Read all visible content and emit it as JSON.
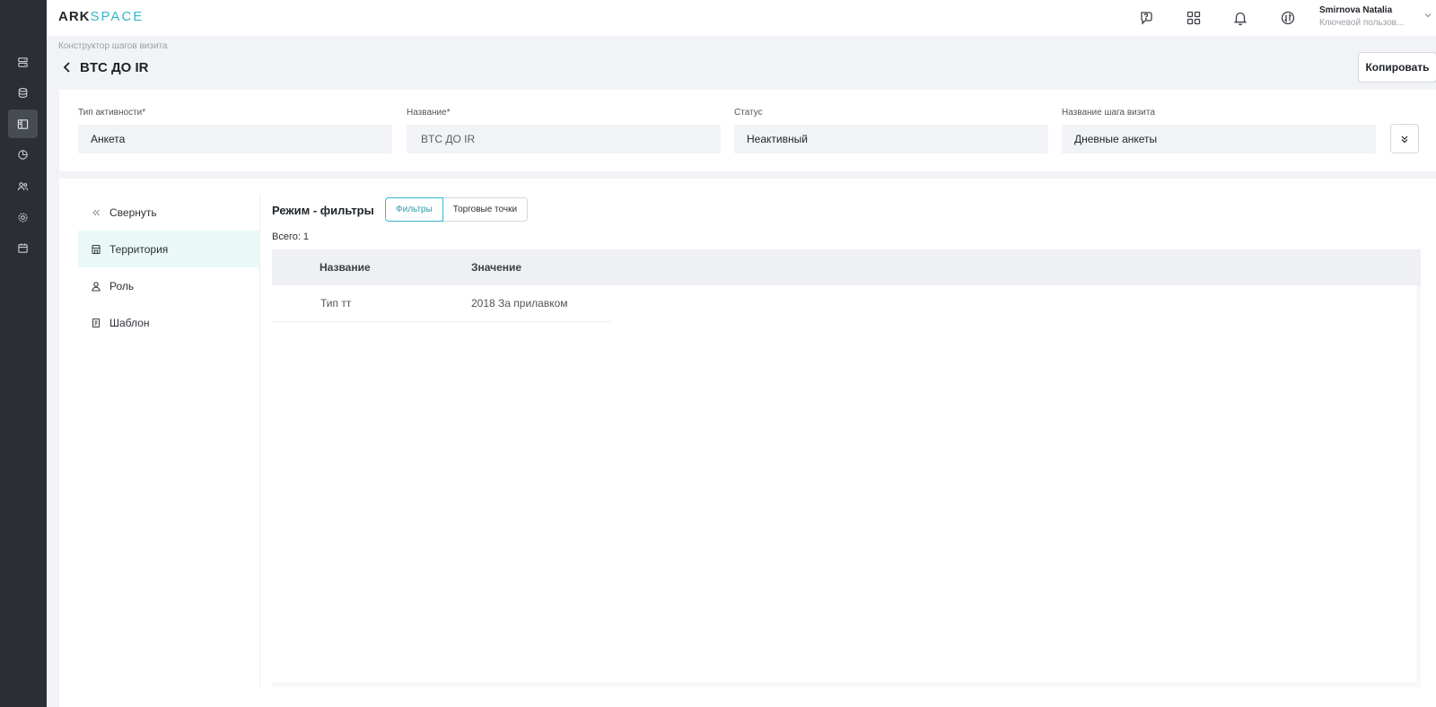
{
  "app": {
    "logo_primary": "ARK",
    "logo_secondary": "SPACE",
    "accent_color": "#34b7c7"
  },
  "rail": {
    "items": [
      {
        "icon": "server-icon",
        "active": false
      },
      {
        "icon": "database-icon",
        "active": false
      },
      {
        "icon": "layout-icon",
        "active": true
      },
      {
        "icon": "pie-chart-icon",
        "active": false
      },
      {
        "icon": "users-icon",
        "active": false
      },
      {
        "icon": "gear-icon",
        "active": false
      },
      {
        "icon": "calendar-icon",
        "active": false
      }
    ]
  },
  "header": {
    "icons": [
      "help-chat-icon",
      "apps-grid-icon",
      "bell-icon",
      "sync-icon"
    ],
    "user": {
      "name": "Smirnova Natalia",
      "role": "Ключевой пользов..."
    }
  },
  "page": {
    "breadcrumb": "Конструктор шагов визита",
    "title": "BTC ДО IR",
    "copy_label": "Копировать"
  },
  "fields": [
    {
      "label": "Тип активности*",
      "value": "Анкета"
    },
    {
      "label": "Название*",
      "value": "BTC ДО IR"
    },
    {
      "label": "Статус",
      "value": "Неактивный"
    },
    {
      "label": "Название шага визита",
      "value": "Дневные анкеты"
    }
  ],
  "sidenav": {
    "collapse_label": "Свернуть",
    "items": [
      {
        "label": "Территория",
        "icon": "store-icon",
        "active": true
      },
      {
        "label": "Роль",
        "icon": "user-icon",
        "active": false
      },
      {
        "label": "Шаблон",
        "icon": "template-icon",
        "active": false
      }
    ]
  },
  "content": {
    "mode_title": "Режим - фильтры",
    "segments": [
      "Фильтры",
      "Торговые точки"
    ],
    "active_segment": "Фильтры",
    "total_label": "Всего:",
    "total_value": "1",
    "table": {
      "columns": [
        "Название",
        "Значение"
      ],
      "rows": [
        [
          "Тип тт",
          "2018 За прилавком"
        ]
      ]
    }
  }
}
